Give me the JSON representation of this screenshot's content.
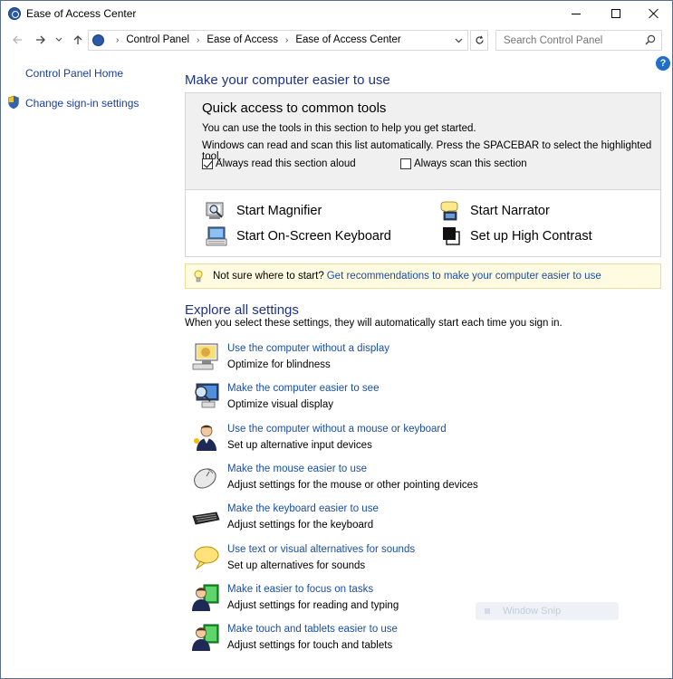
{
  "window": {
    "title": "Ease of Access Center"
  },
  "nav": {
    "breadcrumbs": [
      "Control Panel",
      "Ease of Access",
      "Ease of Access Center"
    ],
    "search_placeholder": "Search Control Panel"
  },
  "sidebar": {
    "home_label": "Control Panel Home",
    "signin_label": "Change sign-in settings"
  },
  "main": {
    "heading": "Make your computer easier to use",
    "quick_access": {
      "title": "Quick access to common tools",
      "desc1": "You can use the tools in this section to help you get started.",
      "desc2": "Windows can read and scan this list automatically.  Press the SPACEBAR to select the highlighted tool.",
      "read_aloud_label": "Always read this section aloud",
      "read_aloud_checked": true,
      "scan_label": "Always scan this section",
      "scan_checked": false
    },
    "tools": {
      "magnifier": "Start Magnifier",
      "narrator": "Start Narrator",
      "osk": "Start On-Screen Keyboard",
      "high_contrast": "Set up High Contrast"
    },
    "tip": {
      "text": "Not sure where to start?",
      "link": "Get recommendations to make your computer easier to use"
    },
    "explore": {
      "heading": "Explore all settings",
      "subtitle": "When you select these settings, they will automatically start each time you sign in.",
      "items": [
        {
          "link": "Use the computer without a display",
          "desc": "Optimize for blindness",
          "icon": "monitor-off-icon"
        },
        {
          "link": "Make the computer easier to see",
          "desc": "Optimize visual display",
          "icon": "monitor-magnify-icon"
        },
        {
          "link": "Use the computer without a mouse or keyboard",
          "desc": "Set up alternative input devices",
          "icon": "user-icon"
        },
        {
          "link": "Make the mouse easier to use",
          "desc": "Adjust settings for the mouse or other pointing devices",
          "icon": "mouse-icon"
        },
        {
          "link": "Make the keyboard easier to use",
          "desc": "Adjust settings for the keyboard",
          "icon": "keyboard-icon"
        },
        {
          "link": "Use text or visual alternatives for sounds",
          "desc": "Set up alternatives for sounds",
          "icon": "speech-bubble-icon"
        },
        {
          "link": "Make it easier to focus on tasks",
          "desc": "Adjust settings for reading and typing",
          "icon": "user-focus-icon"
        },
        {
          "link": "Make touch and tablets easier to use",
          "desc": "Adjust settings for touch and tablets",
          "icon": "user-tablet-icon"
        }
      ]
    }
  },
  "overlay": {
    "window_snip": "Window Snip"
  },
  "colors": {
    "link": "#1a4ea2",
    "heading": "#1e3287",
    "tip_bg": "#fffbe0",
    "quick_bg": "#f0f0f0"
  }
}
